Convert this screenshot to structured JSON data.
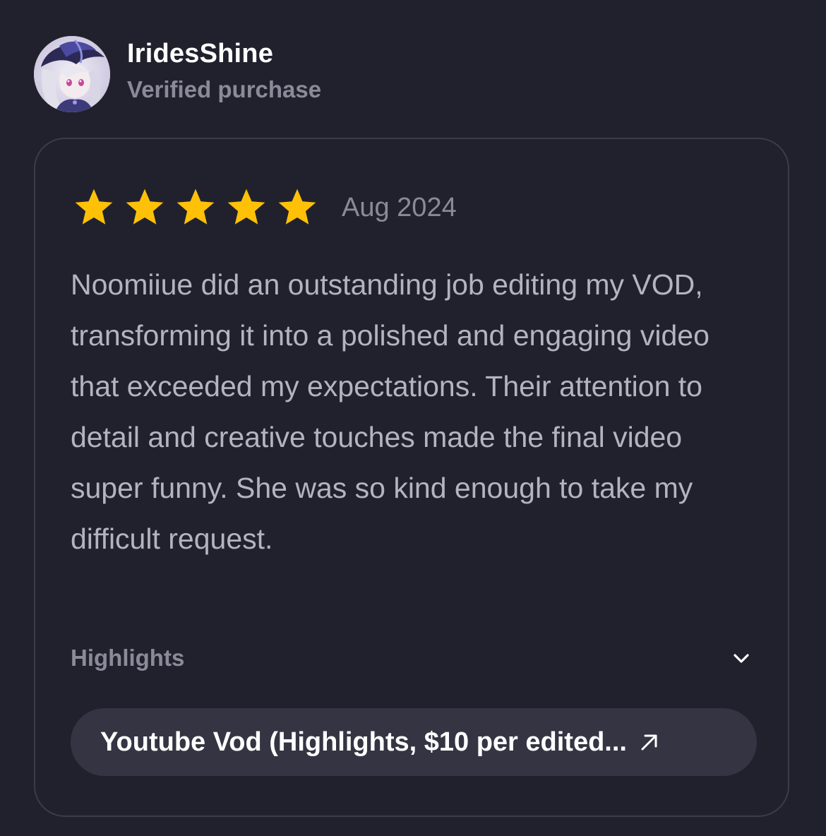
{
  "reviewer": {
    "name": "IridesShine",
    "status": "Verified purchase",
    "avatar_icon": "anime-avatar"
  },
  "review": {
    "rating": 5,
    "rating_max": 5,
    "date": "Aug 2024",
    "text": "Noomiiue did an outstanding job editing my VOD, transforming it into a polished and engaging video that exceeded my expectations. Their attention to detail and creative touches made the final video super funny. She was so kind enough to take my difficult request.",
    "star_color": "#ffc107"
  },
  "highlights": {
    "label": "Highlights",
    "toggle_icon": "chevron-down-icon"
  },
  "service": {
    "label": "Youtube Vod (Highlights, $10 per edited...",
    "link_icon": "arrow-up-right-icon"
  }
}
